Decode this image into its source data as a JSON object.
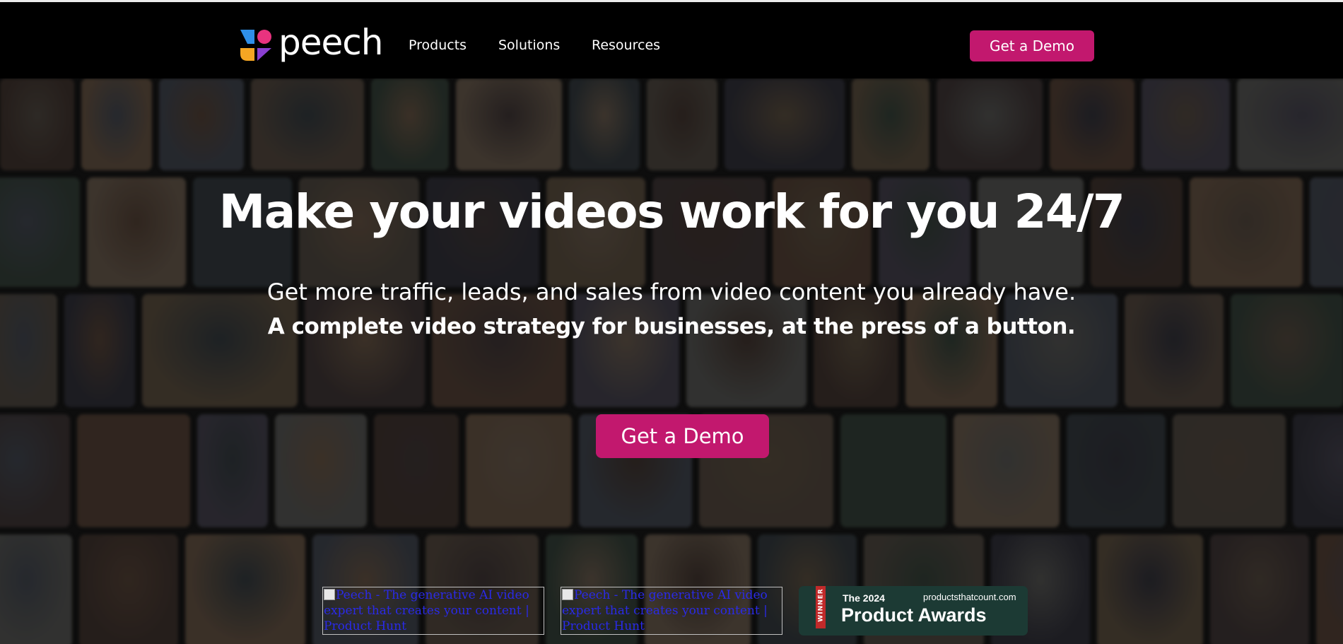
{
  "navbar": {
    "logo_text": "peech",
    "logo_icon": "peech-logo-icon",
    "items": [
      {
        "label": "Products"
      },
      {
        "label": "Solutions"
      },
      {
        "label": "Resources"
      }
    ],
    "cta_label": "Get a Demo"
  },
  "hero": {
    "title": "Make your videos work for you 24/7",
    "subtitle": "Get more traffic, leads, and sales from video content you already have.",
    "subtitle_bold": "A complete video strategy for businesses, at the press of a button.",
    "cta_label": "Get a Demo"
  },
  "badges": [
    {
      "alt_text": "Peech - The generative AI video expert that creates your content | Product Hunt"
    },
    {
      "alt_text": "Peech - The generative AI video expert that creates your content | Product Hunt"
    }
  ],
  "award": {
    "ribbon_text": "WINNER",
    "year_text": "The 2024",
    "site_text": "productsthatcount.com",
    "title": "Product Awards"
  },
  "colors": {
    "brand_pink": "#c2186e",
    "navbar_bg": "#000000",
    "award_bg": "#1c3a34"
  }
}
